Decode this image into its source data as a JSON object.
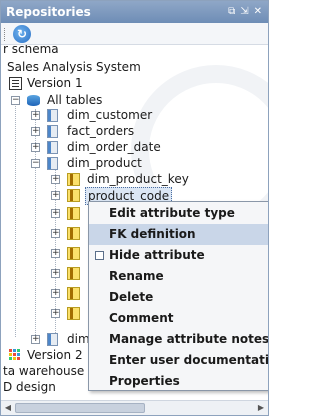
{
  "panel": {
    "title": "Repositories",
    "controls": [
      "⧉",
      "⇲",
      "✕"
    ]
  },
  "toolbar": {
    "refresh_glyph": "↻"
  },
  "tree": {
    "partial_top": "r schema",
    "system": "Sales Analysis System",
    "version1": "Version 1",
    "all_tables": "All tables",
    "tables": [
      "dim_customer",
      "fact_orders",
      "dim_order_date",
      "dim_product"
    ],
    "attributes": [
      "dim_product_key",
      "product_code"
    ],
    "partial_dim": "dim",
    "version2": "Version 2",
    "data_warehouse": "ta warehouse",
    "d_design": "D design"
  },
  "context_menu": {
    "items": [
      {
        "label": "Edit attribute type"
      },
      {
        "label": "FK definition"
      },
      {
        "label": "Hide attribute"
      },
      {
        "label": "Rename"
      },
      {
        "label": "Delete"
      },
      {
        "label": "Comment"
      },
      {
        "label": "Manage attribute notes"
      },
      {
        "label": "Enter user documentation"
      },
      {
        "label": "Properties"
      }
    ],
    "active_index": 1
  },
  "scrollbar": {
    "left_arrow": "◀",
    "right_arrow": "▶"
  }
}
